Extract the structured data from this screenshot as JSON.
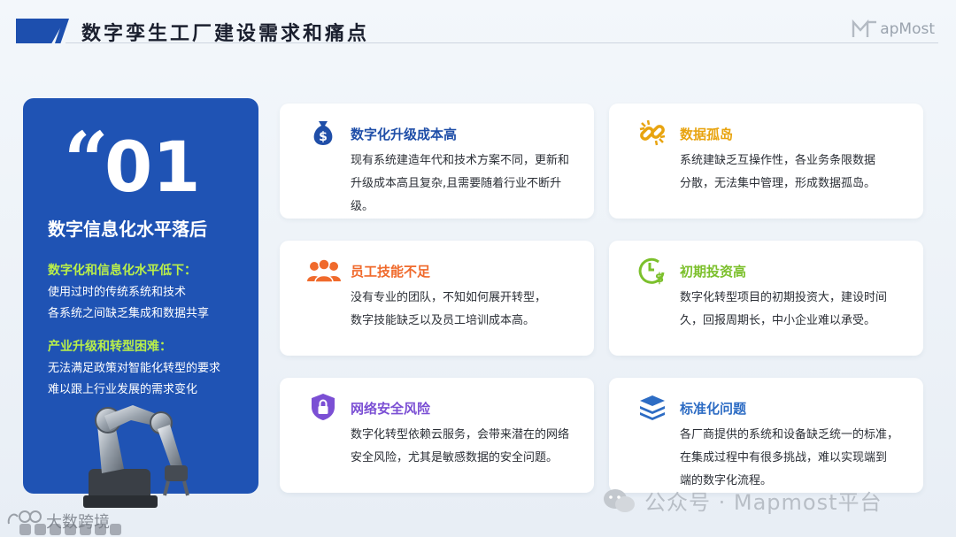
{
  "header": {
    "title": "数字孪生工厂建设需求和痛点",
    "brand": "apMost"
  },
  "left_card": {
    "number": "01",
    "title": "数字信息化水平落后",
    "section1": {
      "heading": "数字化和信息化水平低下：",
      "lines": [
        "使用过时的传统系统和技术",
        "各系统之间缺乏集成和数据共享"
      ]
    },
    "section2": {
      "heading": "产业升级和转型困难：",
      "lines": [
        "无法满足政策对智能化转型的要求",
        "难以跟上行业发展的需求变化"
      ]
    }
  },
  "cards": [
    {
      "title": "数字化升级成本高",
      "lines": [
        "现有系统建造年代和技术方案不同，更新和",
        "升级成本高且复杂,且需要随着行业不断升级。"
      ],
      "color": "#1f4ea8",
      "icon": "money-bag-icon"
    },
    {
      "title": "数据孤岛",
      "lines": [
        "系统建缺乏互操作性，各业务条限数据",
        "分散，无法集中管理，形成数据孤岛。"
      ],
      "color": "#e8a410",
      "icon": "broken-link-icon"
    },
    {
      "title": "员工技能不足",
      "lines": [
        "没有专业的团队，不知如何展开转型，",
        "数字技能缺乏以及员工培训成本高。"
      ],
      "color": "#f06a2c",
      "icon": "team-icon"
    },
    {
      "title": "初期投资高",
      "lines": [
        "数字化转型项目的初期投资大，建设时间",
        "久，回报周期长，中小企业难以承受。"
      ],
      "color": "#7cc02c",
      "icon": "clock-dollar-icon"
    },
    {
      "title": "网络安全风险",
      "lines": [
        "数字化转型依赖云服务，会带来潜在的网络",
        "安全风险，尤其是敏感数据的安全问题。"
      ],
      "color": "#7b4fd4",
      "icon": "shield-lock-icon"
    },
    {
      "title": "标准化问题",
      "lines": [
        "各厂商提供的系统和设备缺乏统一的标准，",
        "在集成过程中有很多挑战，难以实现端到",
        "端的数字化流程。"
      ],
      "color": "#2d6cc4",
      "icon": "stack-icon"
    }
  ],
  "watermark": "公众号 · Mapmost平台",
  "corner_label": "大数跨境"
}
